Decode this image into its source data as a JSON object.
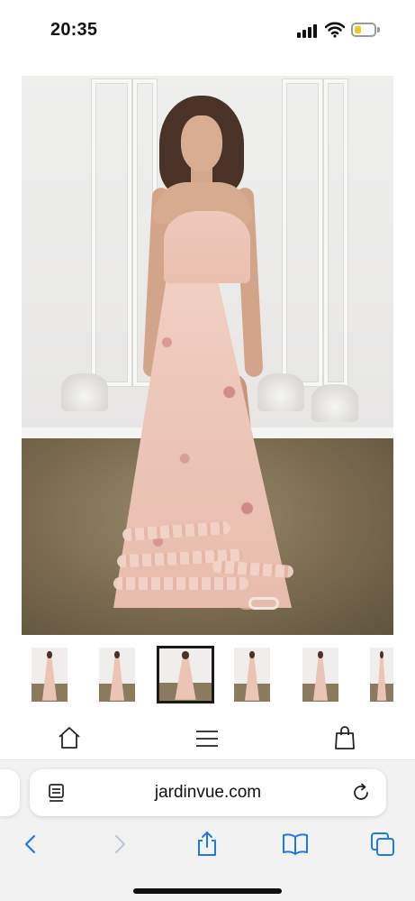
{
  "status_bar": {
    "time": "20:35",
    "icons": [
      "cellular-signal-icon",
      "wifi-icon",
      "battery-icon"
    ],
    "battery_level": 0.35,
    "battery_color": "#f4c81c"
  },
  "product_gallery": {
    "main_image_alt": "",
    "zoom_icon": "zoom-in-icon",
    "thumbnail_count": 6,
    "selected_thumbnail": 3
  },
  "site_nav": {
    "icons": [
      "home-icon",
      "menu-icon",
      "shopping-bag-icon"
    ]
  },
  "browser": {
    "url": "jardinvue.com",
    "reader_icon": "page-format-icon",
    "reload_icon": "reload-icon",
    "toolbar_icons": [
      "back-icon",
      "forward-icon",
      "share-icon",
      "bookmarks-icon",
      "tabs-icon"
    ],
    "accent_color": "#1f7ae0",
    "disabled_color": "#b8c6d8"
  }
}
